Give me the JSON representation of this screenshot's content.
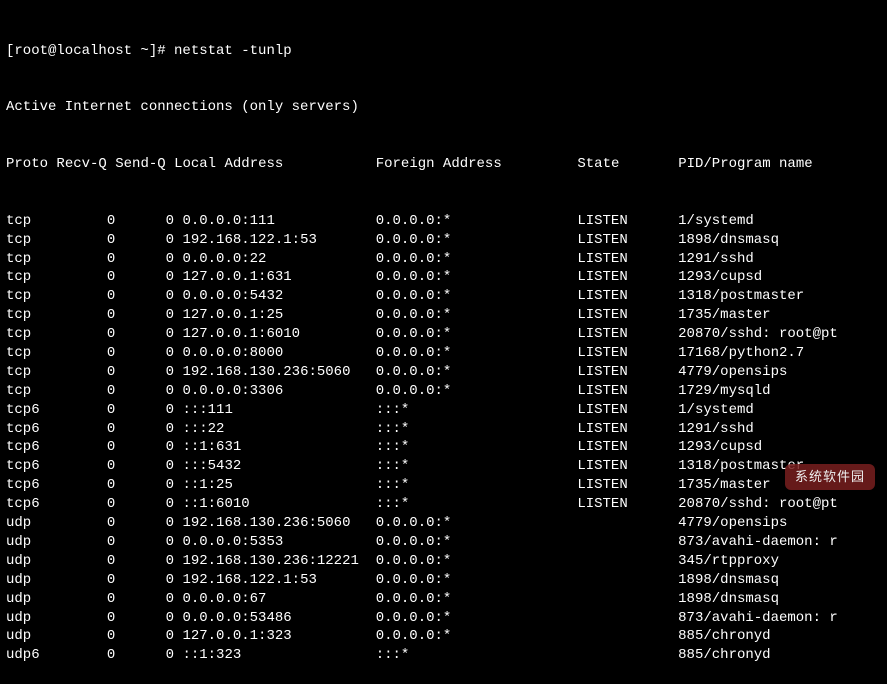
{
  "prompt": "[root@localhost ~]# netstat -tunlp",
  "title": "Active Internet connections (only servers)",
  "headers": {
    "proto": "Proto",
    "recvq": "Recv-Q",
    "sendq": "Send-Q",
    "local": "Local Address",
    "foreign": "Foreign Address",
    "state": "State",
    "pid": "PID/Program name"
  },
  "rows": [
    {
      "proto": "tcp",
      "recvq": "0",
      "sendq": "0",
      "local": "0.0.0.0:111",
      "foreign": "0.0.0.0:*",
      "state": "LISTEN",
      "pid": "1/systemd"
    },
    {
      "proto": "tcp",
      "recvq": "0",
      "sendq": "0",
      "local": "192.168.122.1:53",
      "foreign": "0.0.0.0:*",
      "state": "LISTEN",
      "pid": "1898/dnsmasq"
    },
    {
      "proto": "tcp",
      "recvq": "0",
      "sendq": "0",
      "local": "0.0.0.0:22",
      "foreign": "0.0.0.0:*",
      "state": "LISTEN",
      "pid": "1291/sshd"
    },
    {
      "proto": "tcp",
      "recvq": "0",
      "sendq": "0",
      "local": "127.0.0.1:631",
      "foreign": "0.0.0.0:*",
      "state": "LISTEN",
      "pid": "1293/cupsd"
    },
    {
      "proto": "tcp",
      "recvq": "0",
      "sendq": "0",
      "local": "0.0.0.0:5432",
      "foreign": "0.0.0.0:*",
      "state": "LISTEN",
      "pid": "1318/postmaster"
    },
    {
      "proto": "tcp",
      "recvq": "0",
      "sendq": "0",
      "local": "127.0.0.1:25",
      "foreign": "0.0.0.0:*",
      "state": "LISTEN",
      "pid": "1735/master"
    },
    {
      "proto": "tcp",
      "recvq": "0",
      "sendq": "0",
      "local": "127.0.0.1:6010",
      "foreign": "0.0.0.0:*",
      "state": "LISTEN",
      "pid": "20870/sshd: root@pt"
    },
    {
      "proto": "tcp",
      "recvq": "0",
      "sendq": "0",
      "local": "0.0.0.0:8000",
      "foreign": "0.0.0.0:*",
      "state": "LISTEN",
      "pid": "17168/python2.7"
    },
    {
      "proto": "tcp",
      "recvq": "0",
      "sendq": "0",
      "local": "192.168.130.236:5060",
      "foreign": "0.0.0.0:*",
      "state": "LISTEN",
      "pid": "4779/opensips"
    },
    {
      "proto": "tcp",
      "recvq": "0",
      "sendq": "0",
      "local": "0.0.0.0:3306",
      "foreign": "0.0.0.0:*",
      "state": "LISTEN",
      "pid": "1729/mysqld"
    },
    {
      "proto": "tcp6",
      "recvq": "0",
      "sendq": "0",
      "local": ":::111",
      "foreign": ":::*",
      "state": "LISTEN",
      "pid": "1/systemd"
    },
    {
      "proto": "tcp6",
      "recvq": "0",
      "sendq": "0",
      "local": ":::22",
      "foreign": ":::*",
      "state": "LISTEN",
      "pid": "1291/sshd"
    },
    {
      "proto": "tcp6",
      "recvq": "0",
      "sendq": "0",
      "local": "::1:631",
      "foreign": ":::*",
      "state": "LISTEN",
      "pid": "1293/cupsd"
    },
    {
      "proto": "tcp6",
      "recvq": "0",
      "sendq": "0",
      "local": ":::5432",
      "foreign": ":::*",
      "state": "LISTEN",
      "pid": "1318/postmaster"
    },
    {
      "proto": "tcp6",
      "recvq": "0",
      "sendq": "0",
      "local": "::1:25",
      "foreign": ":::*",
      "state": "LISTEN",
      "pid": "1735/master"
    },
    {
      "proto": "tcp6",
      "recvq": "0",
      "sendq": "0",
      "local": "::1:6010",
      "foreign": ":::*",
      "state": "LISTEN",
      "pid": "20870/sshd: root@pt"
    },
    {
      "proto": "udp",
      "recvq": "0",
      "sendq": "0",
      "local": "192.168.130.236:5060",
      "foreign": "0.0.0.0:*",
      "state": "",
      "pid": "4779/opensips"
    },
    {
      "proto": "udp",
      "recvq": "0",
      "sendq": "0",
      "local": "0.0.0.0:5353",
      "foreign": "0.0.0.0:*",
      "state": "",
      "pid": "873/avahi-daemon: r"
    },
    {
      "proto": "udp",
      "recvq": "0",
      "sendq": "0",
      "local": "192.168.130.236:12221",
      "foreign": "0.0.0.0:*",
      "state": "",
      "pid": "345/rtpproxy"
    },
    {
      "proto": "udp",
      "recvq": "0",
      "sendq": "0",
      "local": "192.168.122.1:53",
      "foreign": "0.0.0.0:*",
      "state": "",
      "pid": "1898/dnsmasq"
    },
    {
      "proto": "udp",
      "recvq": "0",
      "sendq": "0",
      "local": "0.0.0.0:67",
      "foreign": "0.0.0.0:*",
      "state": "",
      "pid": "1898/dnsmasq"
    },
    {
      "proto": "udp",
      "recvq": "0",
      "sendq": "0",
      "local": "0.0.0.0:53486",
      "foreign": "0.0.0.0:*",
      "state": "",
      "pid": "873/avahi-daemon: r"
    },
    {
      "proto": "udp",
      "recvq": "0",
      "sendq": "0",
      "local": "127.0.0.1:323",
      "foreign": "0.0.0.0:*",
      "state": "",
      "pid": "885/chronyd"
    },
    {
      "proto": "udp6",
      "recvq": "0",
      "sendq": "0",
      "local": "::1:323",
      "foreign": ":::*",
      "state": "",
      "pid": "885/chronyd"
    }
  ],
  "watermark": "系统软件园"
}
